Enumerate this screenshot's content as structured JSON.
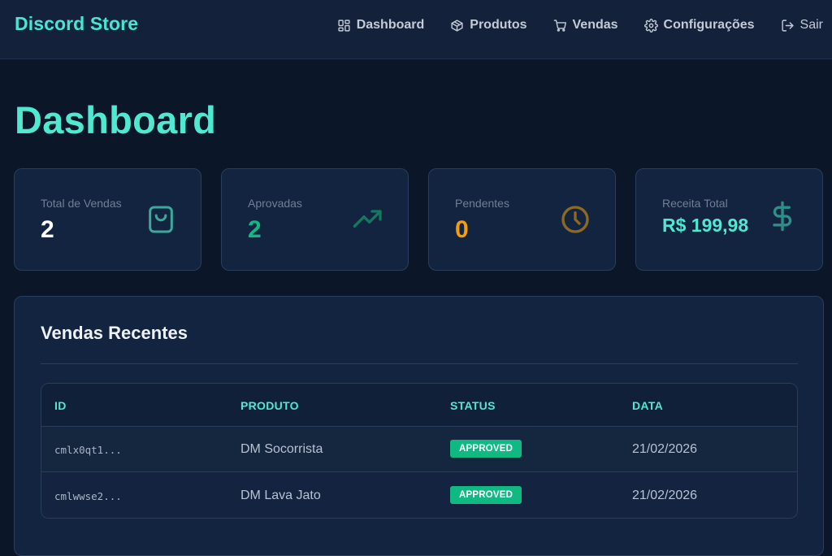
{
  "app": {
    "brand": "Discord Store"
  },
  "nav": {
    "items": [
      {
        "label": "Dashboard",
        "icon": "dashboard-grid-icon"
      },
      {
        "label": "Produtos",
        "icon": "package-icon"
      },
      {
        "label": "Vendas",
        "icon": "shopping-cart-icon"
      },
      {
        "label": "Configurações",
        "icon": "gear-icon"
      },
      {
        "label": "Sair",
        "icon": "logout-icon"
      }
    ]
  },
  "page": {
    "title": "Dashboard"
  },
  "stats": [
    {
      "label": "Total de Vendas",
      "value": "2",
      "icon": "shopping-bag-icon",
      "color": "#ffffff"
    },
    {
      "label": "Aprovadas",
      "value": "2",
      "icon": "trending-up-icon",
      "color": "#10b981"
    },
    {
      "label": "Pendentes",
      "value": "0",
      "icon": "clock-icon",
      "color": "#f59e0b"
    },
    {
      "label": "Receita Total",
      "value": "R$ 199,98",
      "icon": "dollar-sign-icon",
      "color": "#4fe8d0"
    }
  ],
  "recent_sales": {
    "title": "Vendas Recentes",
    "columns": [
      "ID",
      "PRODUTO",
      "STATUS",
      "DATA"
    ],
    "rows": [
      {
        "id": "cmlx0qt1...",
        "product": "DM Socorrista",
        "status": "APPROVED",
        "date": "21/02/2026"
      },
      {
        "id": "cmlwwse2...",
        "product": "DM Lava Jato",
        "status": "APPROVED",
        "date": "21/02/2026"
      }
    ]
  },
  "colors": {
    "accent": "#4fe8d0",
    "approved": "#10b981",
    "pending": "#f59e0b",
    "background": "#0b1628",
    "card": "#132440"
  }
}
